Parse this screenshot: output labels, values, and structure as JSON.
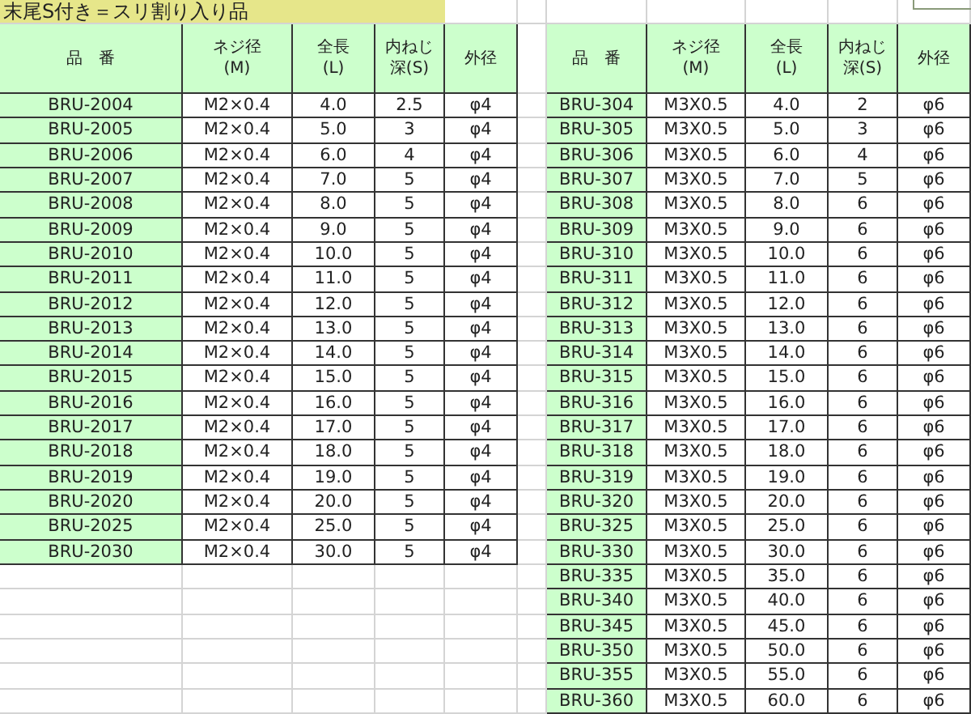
{
  "title": "末尾S付き＝スリ割り入り品",
  "tables": [
    {
      "columns": [
        "品　番",
        "ネジ径(M)",
        "全長(L)",
        "内ねじ深(S)",
        "外径"
      ],
      "rows": [
        [
          "BRU-2004",
          "M2×0.4",
          "4.0",
          "2.5",
          "φ4"
        ],
        [
          "BRU-2005",
          "M2×0.4",
          "5.0",
          "3",
          "φ4"
        ],
        [
          "BRU-2006",
          "M2×0.4",
          "6.0",
          "4",
          "φ4"
        ],
        [
          "BRU-2007",
          "M2×0.4",
          "7.0",
          "5",
          "φ4"
        ],
        [
          "BRU-2008",
          "M2×0.4",
          "8.0",
          "5",
          "φ4"
        ],
        [
          "BRU-2009",
          "M2×0.4",
          "9.0",
          "5",
          "φ4"
        ],
        [
          "BRU-2010",
          "M2×0.4",
          "10.0",
          "5",
          "φ4"
        ],
        [
          "BRU-2011",
          "M2×0.4",
          "11.0",
          "5",
          "φ4"
        ],
        [
          "BRU-2012",
          "M2×0.4",
          "12.0",
          "5",
          "φ4"
        ],
        [
          "BRU-2013",
          "M2×0.4",
          "13.0",
          "5",
          "φ4"
        ],
        [
          "BRU-2014",
          "M2×0.4",
          "14.0",
          "5",
          "φ4"
        ],
        [
          "BRU-2015",
          "M2×0.4",
          "15.0",
          "5",
          "φ4"
        ],
        [
          "BRU-2016",
          "M2×0.4",
          "16.0",
          "5",
          "φ4"
        ],
        [
          "BRU-2017",
          "M2×0.4",
          "17.0",
          "5",
          "φ4"
        ],
        [
          "BRU-2018",
          "M2×0.4",
          "18.0",
          "5",
          "φ4"
        ],
        [
          "BRU-2019",
          "M2×0.4",
          "19.0",
          "5",
          "φ4"
        ],
        [
          "BRU-2020",
          "M2×0.4",
          "20.0",
          "5",
          "φ4"
        ],
        [
          "BRU-2025",
          "M2×0.4",
          "25.0",
          "5",
          "φ4"
        ],
        [
          "BRU-2030",
          "M2×0.4",
          "30.0",
          "5",
          "φ4"
        ]
      ]
    },
    {
      "columns": [
        "品　番",
        "ネジ径(M)",
        "全長(L)",
        "内ねじ深(S)",
        "外径"
      ],
      "rows": [
        [
          "BRU-304",
          "M3X0.5",
          "4.0",
          "2",
          "φ6"
        ],
        [
          "BRU-305",
          "M3X0.5",
          "5.0",
          "3",
          "φ6"
        ],
        [
          "BRU-306",
          "M3X0.5",
          "6.0",
          "4",
          "φ6"
        ],
        [
          "BRU-307",
          "M3X0.5",
          "7.0",
          "5",
          "φ6"
        ],
        [
          "BRU-308",
          "M3X0.5",
          "8.0",
          "6",
          "φ6"
        ],
        [
          "BRU-309",
          "M3X0.5",
          "9.0",
          "6",
          "φ6"
        ],
        [
          "BRU-310",
          "M3X0.5",
          "10.0",
          "6",
          "φ6"
        ],
        [
          "BRU-311",
          "M3X0.5",
          "11.0",
          "6",
          "φ6"
        ],
        [
          "BRU-312",
          "M3X0.5",
          "12.0",
          "6",
          "φ6"
        ],
        [
          "BRU-313",
          "M3X0.5",
          "13.0",
          "6",
          "φ6"
        ],
        [
          "BRU-314",
          "M3X0.5",
          "14.0",
          "6",
          "φ6"
        ],
        [
          "BRU-315",
          "M3X0.5",
          "15.0",
          "6",
          "φ6"
        ],
        [
          "BRU-316",
          "M3X0.5",
          "16.0",
          "6",
          "φ6"
        ],
        [
          "BRU-317",
          "M3X0.5",
          "17.0",
          "6",
          "φ6"
        ],
        [
          "BRU-318",
          "M3X0.5",
          "18.0",
          "6",
          "φ6"
        ],
        [
          "BRU-319",
          "M3X0.5",
          "19.0",
          "6",
          "φ6"
        ],
        [
          "BRU-320",
          "M3X0.5",
          "20.0",
          "6",
          "φ6"
        ],
        [
          "BRU-325",
          "M3X0.5",
          "25.0",
          "6",
          "φ6"
        ],
        [
          "BRU-330",
          "M3X0.5",
          "30.0",
          "6",
          "φ6"
        ],
        [
          "BRU-335",
          "M3X0.5",
          "35.0",
          "6",
          "φ6"
        ],
        [
          "BRU-340",
          "M3X0.5",
          "40.0",
          "6",
          "φ6"
        ],
        [
          "BRU-345",
          "M3X0.5",
          "45.0",
          "6",
          "φ6"
        ],
        [
          "BRU-350",
          "M3X0.5",
          "50.0",
          "6",
          "φ6"
        ],
        [
          "BRU-355",
          "M3X0.5",
          "55.0",
          "6",
          "φ6"
        ],
        [
          "BRU-360",
          "M3X0.5",
          "60.0",
          "6",
          "φ6"
        ]
      ]
    }
  ]
}
